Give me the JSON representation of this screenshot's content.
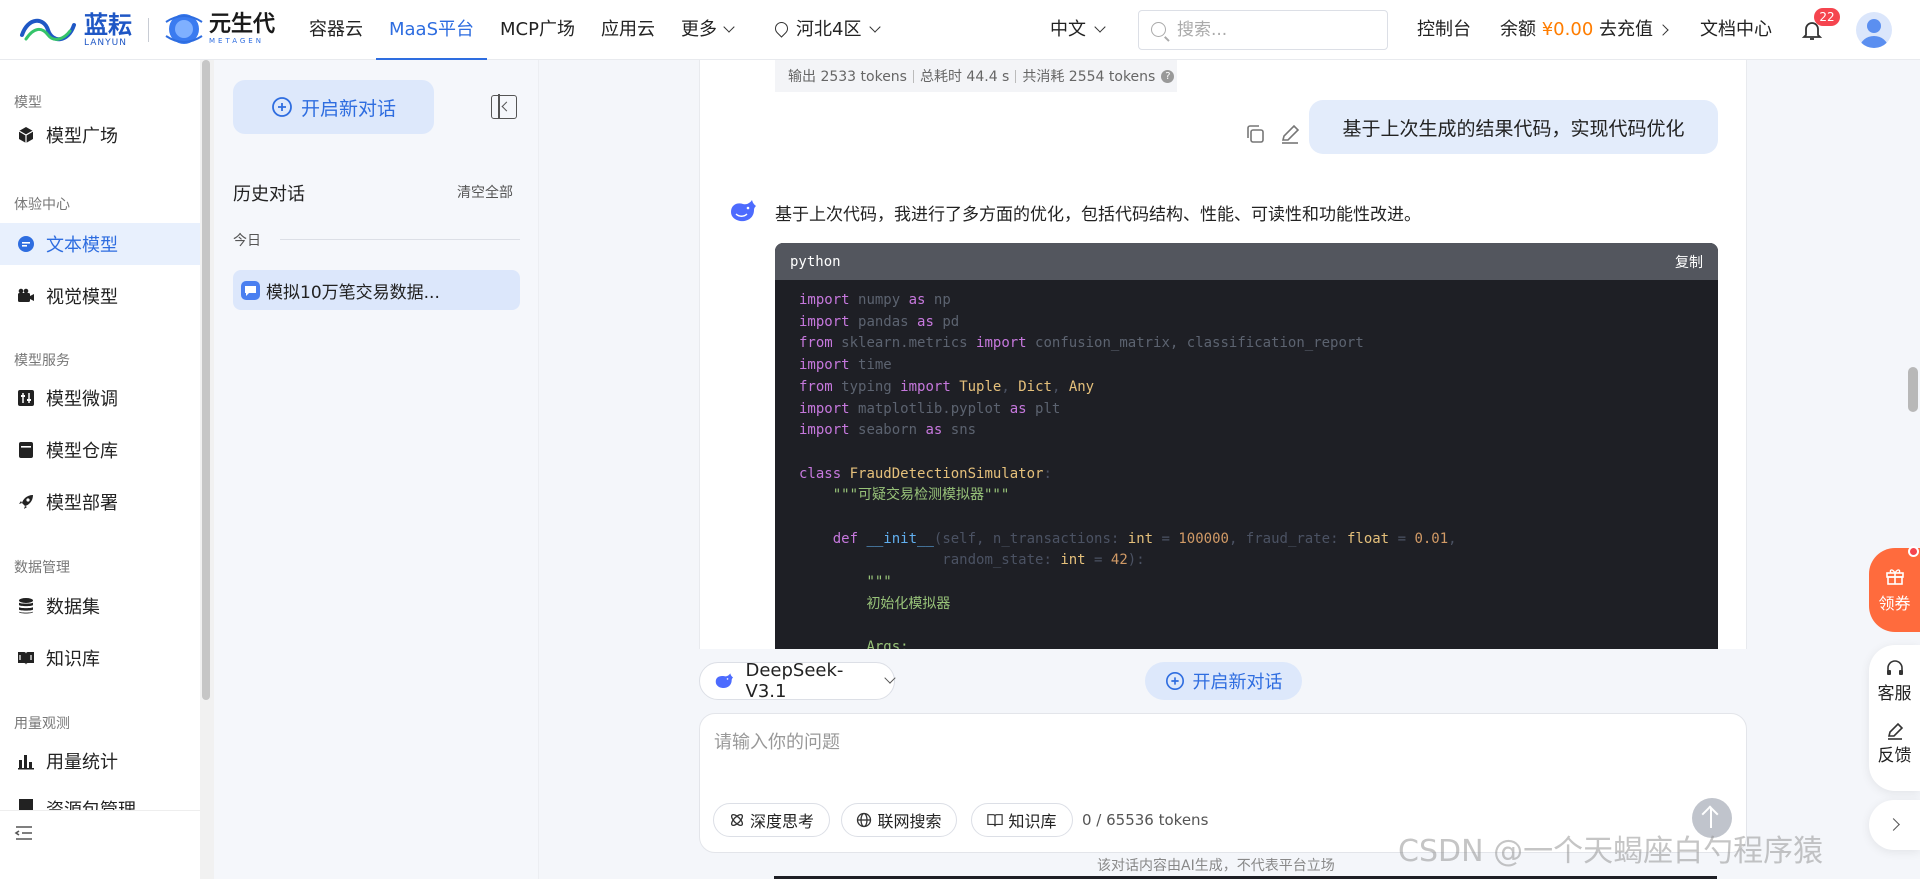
{
  "header": {
    "brand_lanyun_cn": "蓝耘",
    "brand_lanyun_en": "LANYUN",
    "brand_meta_cn": "元生代",
    "brand_meta_en": "METAGEN",
    "nav": [
      {
        "label": "容器云",
        "active": false
      },
      {
        "label": "MaaS平台",
        "active": true
      },
      {
        "label": "MCP广场",
        "active": false
      },
      {
        "label": "应用云",
        "active": false
      },
      {
        "label": "更多",
        "active": false,
        "dropdown": true
      }
    ],
    "region": "河北4区",
    "language": "中文",
    "search_placeholder": "搜索...",
    "console": "控制台",
    "balance_label": "余额",
    "balance_amount": "¥0.00",
    "recharge": "去充值",
    "docs": "文档中心",
    "notification_count": "22",
    "accent_color": "#2e6de0"
  },
  "sidebar": {
    "section_model": "模型",
    "model_square": "模型广场",
    "section_experience": "体验中心",
    "text_model": "文本模型",
    "vision_model": "视觉模型",
    "section_service": "模型服务",
    "fine_tune": "模型微调",
    "repo": "模型仓库",
    "deploy": "模型部署",
    "section_data": "数据管理",
    "dataset": "数据集",
    "knowledge": "知识库",
    "section_usage": "用量观测",
    "usage_stats": "用量统计",
    "resource_mgmt": "资源包管理"
  },
  "history": {
    "new_chat": "开启新对话",
    "title": "历史对话",
    "clear_all": "清空全部",
    "today": "今日",
    "items": [
      {
        "label": "模拟10万笔交易数据..."
      }
    ]
  },
  "chat": {
    "stats": {
      "output": "输出 2533 tokens",
      "time": "总耗时 44.4 s",
      "total": "共消耗 2554 tokens"
    },
    "user_message": "基于上次生成的结果代码，实现代码优化",
    "ai_intro": "基于上次代码，我进行了多方面的优化，包括代码结构、性能、可读性和功能性改进。",
    "code_lang": "python",
    "code_copy": "复制"
  },
  "composer": {
    "model": "DeepSeek-V3.1",
    "new_chat": "开启新对话",
    "placeholder": "请输入你的问题",
    "deep_think": "深度思考",
    "web_search": "联网搜索",
    "knowledge": "知识库",
    "tokens": "0 / 65536 tokens",
    "disclaimer": "该对话内容由AI生成，不代表平台立场"
  },
  "float": {
    "coupon": "领券",
    "service": "客服",
    "feedback": "反馈"
  },
  "watermark": "CSDN @一个天蝎座白勺程序猿"
}
